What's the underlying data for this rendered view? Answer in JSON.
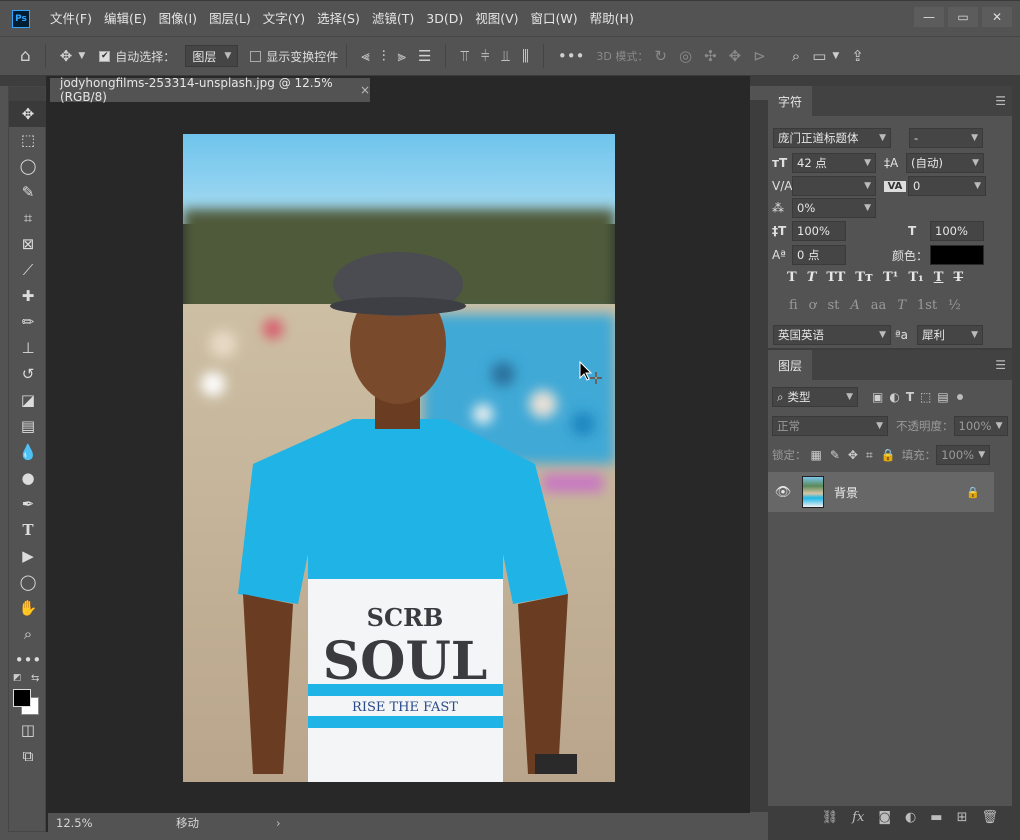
{
  "menubar": {
    "logo": "Ps",
    "items": [
      "文件(F)",
      "编辑(E)",
      "图像(I)",
      "图层(L)",
      "文字(Y)",
      "选择(S)",
      "滤镜(T)",
      "3D(D)",
      "视图(V)",
      "窗口(W)",
      "帮助(H)"
    ]
  },
  "options": {
    "auto_select_label": "自动选择：",
    "auto_select_target": "图层",
    "show_transform_label": "显示变换控件",
    "mode_3d_label": "3D 模式："
  },
  "document": {
    "tab_title": "jodyhongfilms-253314-unsplash.jpg @ 12.5%(RGB/8)",
    "tab_close": "×",
    "zoom": "12.5%",
    "status_text": "移动",
    "shirt_text_top": "SCRB",
    "shirt_text_main": "SOUL",
    "shirt_text_sub": "RISE THE FAST"
  },
  "character_panel": {
    "tab_label": "字符",
    "font_family": "庞门正道标题体",
    "font_style": "-",
    "font_size": "42 点",
    "leading": "(自动)",
    "kerning": "",
    "tracking": "0",
    "tsume": "0%",
    "vertical_scale": "100%",
    "horizontal_scale": "100%",
    "baseline_shift": "0 点",
    "color_label": "颜色：",
    "color": "#000000",
    "language": "英国英语",
    "aa_label": "ªa",
    "antialias": "犀利",
    "style_glyphs": [
      "T",
      "T",
      "TT",
      "Tт",
      "T¹",
      "T₁",
      "T",
      "T"
    ],
    "opentype_glyphs": [
      "fi",
      "ơ",
      "st",
      "A",
      "aa",
      "T",
      "1st",
      "½"
    ]
  },
  "layers_panel": {
    "tab_label": "图层",
    "filter_label": "类型",
    "blend_mode": "正常",
    "opacity_label": "不透明度：",
    "opacity_value": "100%",
    "lock_label": "锁定：",
    "fill_label": "填充：",
    "fill_value": "100%",
    "layers": [
      {
        "name": "背景",
        "visible": true,
        "locked": true
      }
    ]
  },
  "colors": {
    "accent": "#31a8ff",
    "panel_bg": "#535353",
    "canvas_bg": "#282828"
  }
}
